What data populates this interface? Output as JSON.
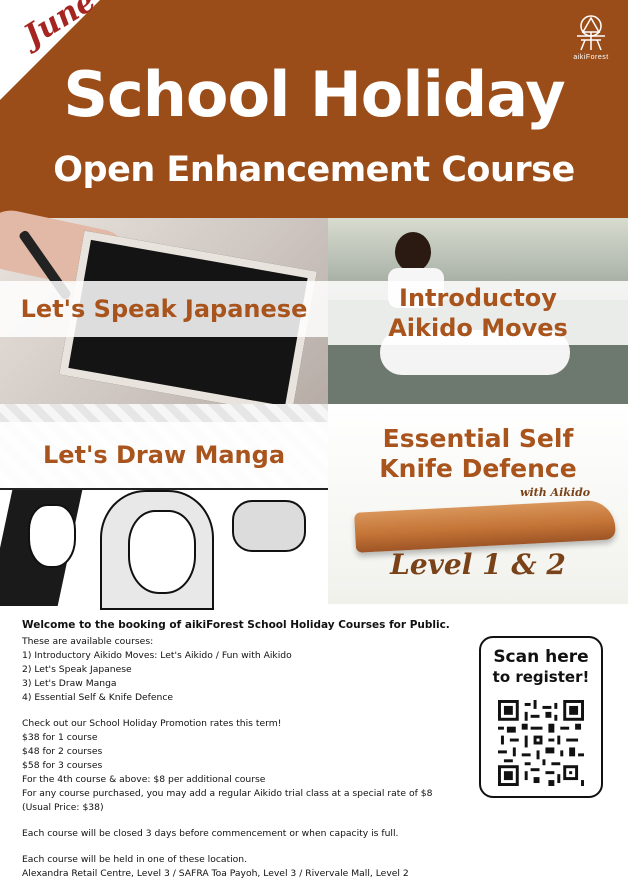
{
  "header": {
    "month": "June",
    "title": "School Holiday",
    "subtitle": "Open Enhancement Course",
    "logo_text": "aikiForest"
  },
  "panels": [
    {
      "title": "Let's Speak Japanese"
    },
    {
      "title_line1": "Introductoy",
      "title_line2": "Aikido Moves"
    },
    {
      "title": "Let's Draw Manga"
    },
    {
      "title_line1": "Essential Self",
      "title_line2": "Knife Defence",
      "tag": "with Aikido",
      "level": "Level 1 & 2"
    }
  ],
  "info": {
    "lead": "Welcome to the booking of aikiForest School Holiday Courses for Public.",
    "intro": "These are available courses:",
    "courses": [
      "1) Introductory Aikido Moves: Let's Aikido / Fun with Aikido",
      "2) Let's Speak Japanese",
      "3) Let's Draw Manga",
      "4) Essential Self & Knife Defence"
    ],
    "promo_intro": "Check out our School Holiday Promotion rates this term!",
    "rates": [
      "$38 for 1 course",
      "$48 for 2 courses",
      "$58 for 3 courses",
      "For the 4th course & above: $8 per additional course",
      "For any course purchased, you may add a regular Aikido trial class at a special rate of $8 (Usual Price: $38)"
    ],
    "closing_note": "Each course will be closed 3 days before commencement or when capacity is full.",
    "location_intro": "Each course will be held in one of these location.",
    "locations": "Alexandra Retail Centre, Level 3 / SAFRA Toa Payoh, Level 3 / Rivervale Mall, Level 2"
  },
  "register": {
    "line1": "Scan here",
    "line2": "to register!"
  },
  "colors": {
    "header_brown": "#9b4d19",
    "panel_text": "#a8541c",
    "month_red": "#a52621"
  }
}
